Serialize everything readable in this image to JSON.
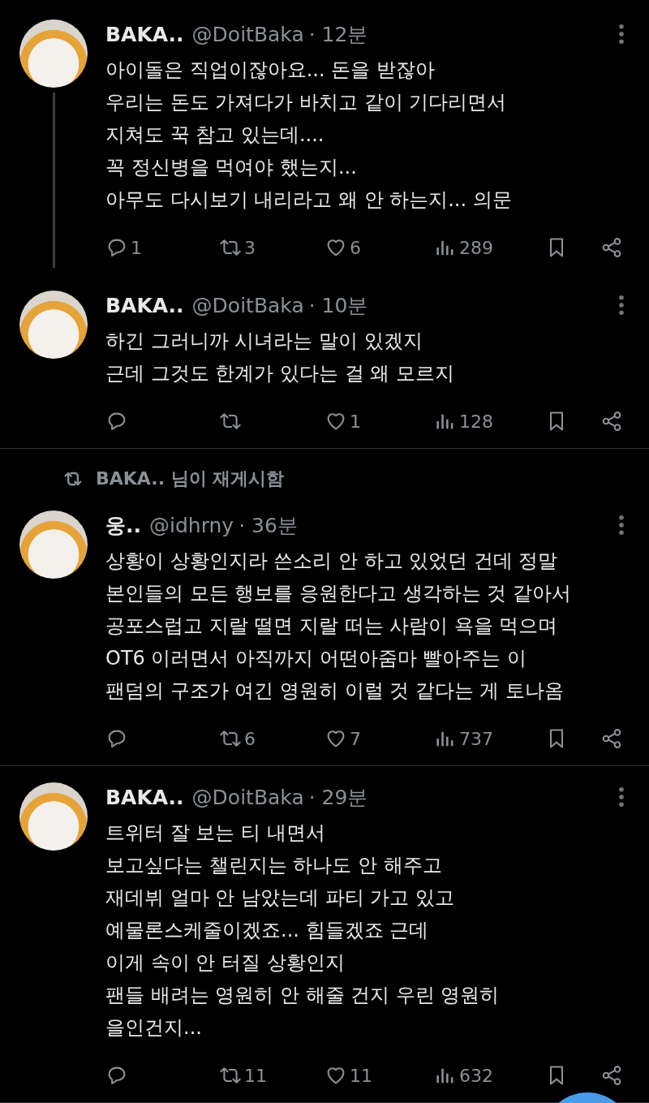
{
  "tweets": [
    {
      "name": "BAKA..",
      "handle": "@DoitBaka",
      "time": "· 12분",
      "thread_continues": true,
      "body": "아이돌은 직업이잖아요... 돈을 받잖아\n우리는 돈도 가져다가 바치고 같이 기다리면서\n지쳐도 꾹 참고 있는데....\n꼭 정신병을 먹여야 했는지...\n아무도 다시보기 내리라고 왜 안 하는지... 의문",
      "counts": {
        "reply": "1",
        "repost": "3",
        "like": "6",
        "views": "289"
      }
    },
    {
      "name": "BAKA..",
      "handle": "@DoitBaka",
      "time": "· 10분",
      "thread_continues": false,
      "body": "하긴 그러니까 시녀라는 말이 있겠지\n근데 그것도 한계가 있다는 걸 왜 모르지",
      "counts": {
        "like": "1",
        "views": "128"
      }
    },
    {
      "reposted_by": "BAKA.. 님이 재게시함",
      "name": "웅..",
      "handle": "@idhrny",
      "time": "· 36분",
      "thread_continues": false,
      "body": "상황이 상황인지라 쓴소리 안 하고 있었던 건데 정말\n본인들의 모든 행보를 응원한다고 생각하는 것 같아서\n공포스럽고 지랄 떨면 지랄 떠는 사람이 욕을 먹으며\nOT6 이러면서 아직까지 어떤아줌마 빨아주는 이\n팬덤의 구조가 여긴 영원히 이럴 것 같다는 게 토나옴",
      "counts": {
        "repost": "6",
        "like": "7",
        "views": "737"
      }
    },
    {
      "name": "BAKA..",
      "handle": "@DoitBaka",
      "time": "· 29분",
      "thread_continues": false,
      "body": "트위터 잘 보는 티 내면서\n보고싶다는 챌린지는 하나도 안 해주고\n재데뷔 얼마 안 남았는데 파티 가고 있고\n예물론스케줄이겠죠... 힘들겠죠 근데\n이게 속이 안 터질 상황인지\n팬들 배려는 영원히 안 해줄 건지 우린 영원히\n을인건지...",
      "counts": {
        "repost": "11",
        "like": "11",
        "views": "632"
      }
    }
  ]
}
